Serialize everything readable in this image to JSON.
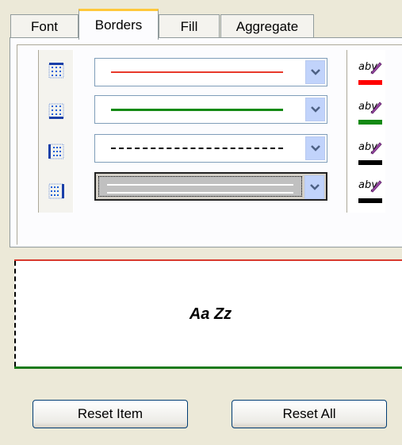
{
  "tabs": [
    {
      "label": "Font",
      "active": false
    },
    {
      "label": "Borders",
      "active": true
    },
    {
      "label": "Fill",
      "active": false
    },
    {
      "label": "Aggregate",
      "active": false
    }
  ],
  "border_rows": [
    {
      "position": "top",
      "style": "solid",
      "color": "#E8392B",
      "selected": false
    },
    {
      "position": "bottom",
      "style": "solid",
      "color": "#148A14",
      "selected": false
    },
    {
      "position": "left",
      "style": "dashed",
      "color": "#000000",
      "selected": false
    },
    {
      "position": "right",
      "style": "double",
      "color": "#000000",
      "selected": true
    }
  ],
  "color_buttons": [
    {
      "label": "aby",
      "color": "#FF0000"
    },
    {
      "label": "aby",
      "color": "#148A14"
    },
    {
      "label": "aby",
      "color": "#000000"
    },
    {
      "label": "aby",
      "color": "#000000"
    }
  ],
  "preview": {
    "sample_text": "Aa Zz"
  },
  "buttons": {
    "reset_item": "Reset Item",
    "reset_all": "Reset All"
  }
}
